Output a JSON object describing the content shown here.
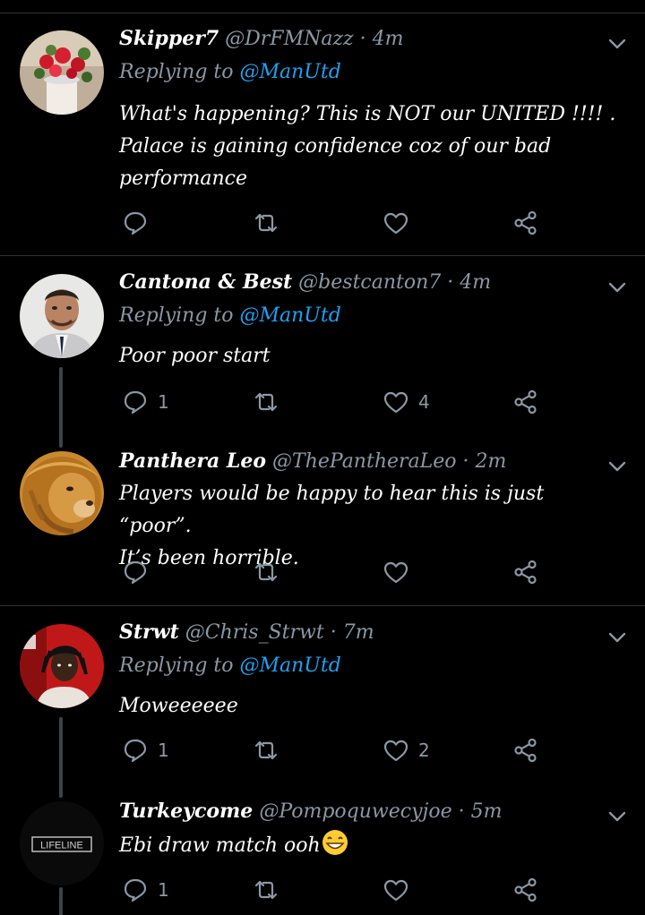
{
  "colors": {
    "background": "#000000",
    "name": "#ffffff",
    "meta": "#8b98a5",
    "mention": "#1da1f2",
    "divider": "#2f3336"
  },
  "tweets": [
    {
      "name": "Skipper7",
      "handle": "@DrFMNazz",
      "dot": "·",
      "time": "4m",
      "replying_prefix": "Replying to",
      "replying_to": "@ManUtd",
      "text_lines": [
        "What's happening? This is NOT our UNITED !!!! .",
        "Palace is gaining confidence coz of our bad",
        "performance"
      ],
      "replies": "",
      "likes": "",
      "avatar_icon": "flowers-avatar"
    },
    {
      "name": "Cantona & Best",
      "handle": "@bestcanton7",
      "dot": "·",
      "time": "4m",
      "replying_prefix": "Replying to",
      "replying_to": "@ManUtd",
      "text_lines": [
        "Poor poor start"
      ],
      "replies": "1",
      "likes": "4",
      "avatar_icon": "man-avatar"
    },
    {
      "name": "Panthera Leo",
      "handle": "@ThePantheraLeo",
      "dot": "·",
      "time": "2m",
      "text_lines": [
        "Players would be happy to hear this is just “poor”.",
        "It’s been horrible."
      ],
      "replies": "",
      "likes": "",
      "avatar_icon": "lion-avatar"
    },
    {
      "name": "Strwt",
      "handle": "@Chris_Strwt",
      "dot": "·",
      "time": "7m",
      "replying_prefix": "Replying to",
      "replying_to": "@ManUtd",
      "text_lines": [
        "Mowееееее"
      ],
      "replies": "1",
      "likes": "2",
      "avatar_icon": "person-red-avatar"
    },
    {
      "name": "Turkeycome",
      "handle": "@Pompoquwecyjoe",
      "dot": "·",
      "time": "5m",
      "text_lines": [
        "Ebi draw match ooh"
      ],
      "replies": "1",
      "likes": "",
      "avatar_icon": "lifeline-avatar",
      "avatar_text": "LIFELINE"
    }
  ]
}
